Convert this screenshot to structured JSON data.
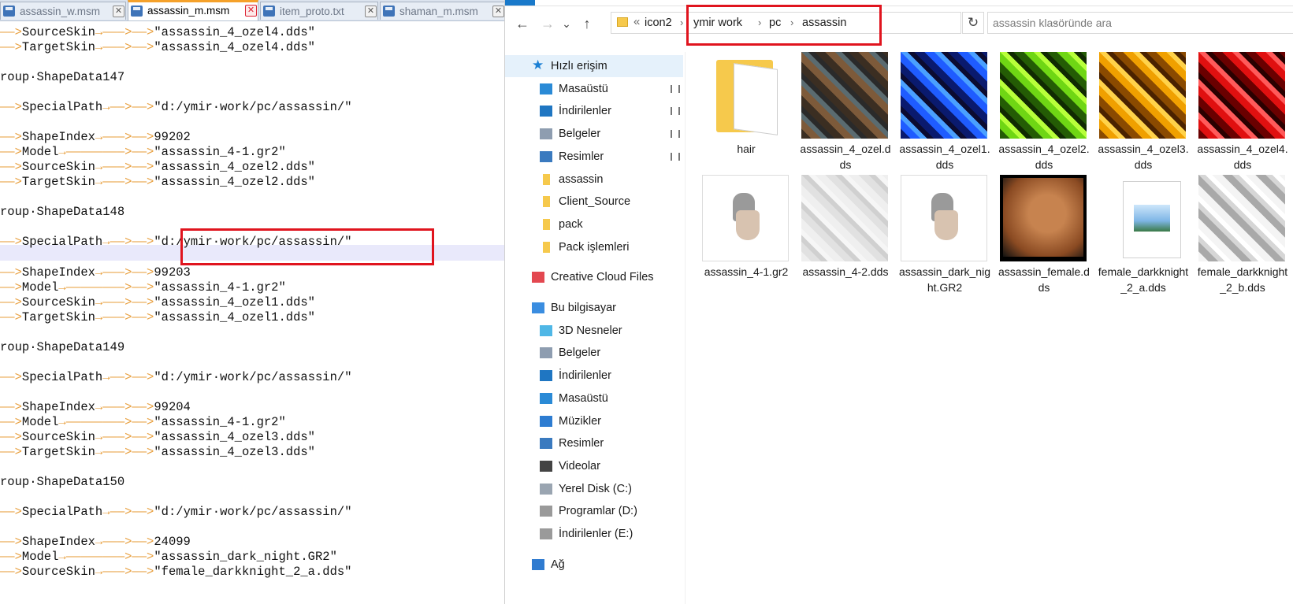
{
  "editor": {
    "tabs": [
      {
        "label": "assassin_w.msm",
        "active": false
      },
      {
        "label": "assassin_m.msm",
        "active": true
      },
      {
        "label": "item_proto.txt",
        "active": false
      },
      {
        "label": "shaman_m.msm",
        "active": false
      }
    ],
    "tab_close_glyph": "✕",
    "arrow_glyph": "→",
    "lines": [
      {
        "indent": true,
        "key": "SourceSkin",
        "value": "\"assassin_4_ozel4.dds\""
      },
      {
        "indent": true,
        "key": "TargetSkin",
        "value": "\"assassin_4_ozel4.dds\""
      },
      {
        "indent": false,
        "key": "roup·ShapeData147",
        "value": ""
      },
      {
        "indent": true,
        "key": "SpecialPath",
        "value": "\"d:/ymir·work/pc/assassin/\""
      },
      {
        "indent": true,
        "key": "ShapeIndex",
        "value": "99202"
      },
      {
        "indent": true,
        "key": "Model",
        "value": "\"assassin_4-1.gr2\""
      },
      {
        "indent": true,
        "key": "SourceSkin",
        "value": "\"assassin_4_ozel2.dds\""
      },
      {
        "indent": true,
        "key": "TargetSkin",
        "value": "\"assassin_4_ozel2.dds\""
      },
      {
        "indent": false,
        "key": "roup·ShapeData148",
        "value": ""
      },
      {
        "indent": true,
        "key": "SpecialPath",
        "value": "\"d:/ymir·work/pc/assassin/\""
      },
      {
        "indent": true,
        "key": "ShapeIndex",
        "value": "99203"
      },
      {
        "indent": true,
        "key": "Model",
        "value": "\"assassin_4-1.gr2\""
      },
      {
        "indent": true,
        "key": "SourceSkin",
        "value": "\"assassin_4_ozel1.dds\""
      },
      {
        "indent": true,
        "key": "TargetSkin",
        "value": "\"assassin_4_ozel1.dds\""
      },
      {
        "indent": false,
        "key": "roup·ShapeData149",
        "value": ""
      },
      {
        "indent": true,
        "key": "SpecialPath",
        "value": "\"d:/ymir·work/pc/assassin/\""
      },
      {
        "indent": true,
        "key": "ShapeIndex",
        "value": "99204"
      },
      {
        "indent": true,
        "key": "Model",
        "value": "\"assassin_4-1.gr2\""
      },
      {
        "indent": true,
        "key": "SourceSkin",
        "value": "\"assassin_4_ozel3.dds\""
      },
      {
        "indent": true,
        "key": "TargetSkin",
        "value": "\"assassin_4_ozel3.dds\""
      },
      {
        "indent": false,
        "key": "roup·ShapeData150",
        "value": ""
      },
      {
        "indent": true,
        "key": "SpecialPath",
        "value": "\"d:/ymir·work/pc/assassin/\""
      },
      {
        "indent": true,
        "key": "ShapeIndex",
        "value": "24099"
      },
      {
        "indent": true,
        "key": "Model",
        "value": "\"assassin_dark_night.GR2\""
      },
      {
        "indent": true,
        "key": "SourceSkin",
        "value": "\"female_darkknight_2_a.dds\""
      }
    ]
  },
  "explorer": {
    "nav_buttons": {
      "back": "←",
      "forward": "→",
      "recent": "⌄",
      "up": "↑"
    },
    "breadcrumb": {
      "overflow": "«",
      "items": [
        "icon2",
        "ymir work",
        "pc",
        "assassin"
      ],
      "separator": "›",
      "dropdown": "⌄"
    },
    "refresh": "↻",
    "search_placeholder": "assassin klasöründe ara",
    "nav_items": [
      {
        "label": "Hızlı erişim",
        "icon": "star-icon",
        "level": 0,
        "selected": true,
        "pinned": false
      },
      {
        "label": "Masaüstü",
        "icon": "desktop-icon",
        "level": 1,
        "selected": false,
        "pinned": true
      },
      {
        "label": "İndirilenler",
        "icon": "download-icon",
        "level": 1,
        "selected": false,
        "pinned": true
      },
      {
        "label": "Belgeler",
        "icon": "documents-icon",
        "level": 1,
        "selected": false,
        "pinned": true
      },
      {
        "label": "Resimler",
        "icon": "pictures-icon",
        "level": 1,
        "selected": false,
        "pinned": true
      },
      {
        "label": "assassin",
        "icon": "folder-icon",
        "level": 1,
        "selected": false,
        "pinned": false
      },
      {
        "label": "Client_Source",
        "icon": "folder-icon",
        "level": 1,
        "selected": false,
        "pinned": false
      },
      {
        "label": "pack",
        "icon": "folder-icon",
        "level": 1,
        "selected": false,
        "pinned": false
      },
      {
        "label": "Pack işlemleri",
        "icon": "folder-icon",
        "level": 1,
        "selected": false,
        "pinned": false
      },
      {
        "label": "Creative Cloud Files",
        "icon": "creative-cloud-icon",
        "level": 0,
        "selected": false,
        "pinned": false
      },
      {
        "label": "Bu bilgisayar",
        "icon": "computer-icon",
        "level": 0,
        "selected": false,
        "pinned": false
      },
      {
        "label": "3D Nesneler",
        "icon": "3d-objects-icon",
        "level": 1,
        "selected": false,
        "pinned": false
      },
      {
        "label": "Belgeler",
        "icon": "documents-icon",
        "level": 1,
        "selected": false,
        "pinned": false
      },
      {
        "label": "İndirilenler",
        "icon": "download-icon",
        "level": 1,
        "selected": false,
        "pinned": false
      },
      {
        "label": "Masaüstü",
        "icon": "desktop-icon",
        "level": 1,
        "selected": false,
        "pinned": false
      },
      {
        "label": "Müzikler",
        "icon": "music-icon",
        "level": 1,
        "selected": false,
        "pinned": false
      },
      {
        "label": "Resimler",
        "icon": "pictures-icon",
        "level": 1,
        "selected": false,
        "pinned": false
      },
      {
        "label": "Videolar",
        "icon": "videos-icon",
        "level": 1,
        "selected": false,
        "pinned": false
      },
      {
        "label": "Yerel Disk (C:)",
        "icon": "windows-drive-icon",
        "level": 1,
        "selected": false,
        "pinned": false
      },
      {
        "label": "Programlar (D:)",
        "icon": "drive-icon",
        "level": 1,
        "selected": false,
        "pinned": false
      },
      {
        "label": "İndirilenler (E:)",
        "icon": "drive-icon",
        "level": 1,
        "selected": false,
        "pinned": false
      },
      {
        "label": "Ağ",
        "icon": "network-icon",
        "level": 0,
        "selected": false,
        "pinned": false
      }
    ],
    "pin_glyph": "📌",
    "files": [
      {
        "name": "hair",
        "kind": "folder-icon",
        "colors": [
          "#f6c94c"
        ]
      },
      {
        "name": "assassin_4_ozel.dds",
        "kind": "texture",
        "colors": [
          "#3b2e22",
          "#7d5a3a",
          "#5a6b70",
          "#2a2a2a"
        ]
      },
      {
        "name": "assassin_4_ozel1.dds",
        "kind": "texture",
        "colors": [
          "#0a1a6e",
          "#1f5cff",
          "#4aa0ff",
          "#0b0b30"
        ]
      },
      {
        "name": "assassin_4_ozel2.dds",
        "kind": "texture",
        "colors": [
          "#245c05",
          "#6fd614",
          "#b8ff3a",
          "#102a02"
        ]
      },
      {
        "name": "assassin_4_ozel3.dds",
        "kind": "texture",
        "colors": [
          "#8a4a00",
          "#f0a000",
          "#ffd24a",
          "#4a2200"
        ]
      },
      {
        "name": "assassin_4_ozel4.dds",
        "kind": "texture",
        "colors": [
          "#6a0000",
          "#e01010",
          "#ff5a5a",
          "#2a0000"
        ]
      },
      {
        "name": "assassin_4-1.gr2",
        "kind": "gr2-icon",
        "colors": [
          "#d8c3b0"
        ]
      },
      {
        "name": "assassin_4-2.dds",
        "kind": "texture-light",
        "colors": [
          "#ececec",
          "#dcdcdc",
          "#c8c8c8",
          "#f4f4f4"
        ]
      },
      {
        "name": "assassin_dark_night.GR2",
        "kind": "gr2-icon",
        "colors": [
          "#d8c3b0"
        ]
      },
      {
        "name": "assassin_female.dds",
        "kind": "face",
        "colors": [
          "#000000",
          "#c7834f",
          "#8a4a22",
          "#111111"
        ]
      },
      {
        "name": "female_darkknight_2_a.dds",
        "kind": "image-file-icon",
        "colors": [
          "#7fb6e6"
        ]
      },
      {
        "name": "female_darkknight_2_b.dds",
        "kind": "texture-light",
        "colors": [
          "#f2f2f2",
          "#9a9a9a",
          "#cfcfcf",
          "#ffffff"
        ]
      }
    ]
  }
}
